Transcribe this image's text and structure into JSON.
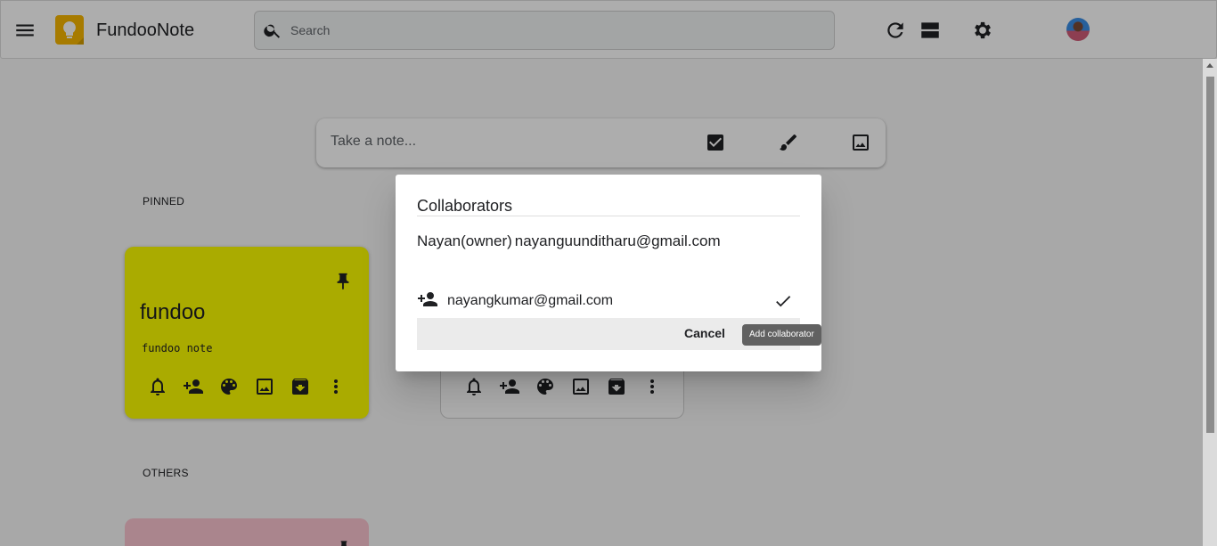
{
  "header": {
    "app_title": "FundooNote",
    "search_placeholder": "Search",
    "icons": [
      "menu-icon",
      "keep-logo-icon",
      "search-icon",
      "refresh-icon",
      "list-view-icon",
      "settings-icon",
      "avatar"
    ]
  },
  "composer": {
    "placeholder": "Take a note...",
    "icons": [
      "checkbox-icon",
      "brush-icon",
      "image-icon"
    ]
  },
  "sections": {
    "pinned": "PINNED",
    "others": "OTHERS"
  },
  "notes": [
    {
      "title": "fundoo",
      "body": "fundoo note",
      "color": "#fbfd00",
      "pinned": true
    },
    {
      "title": "",
      "body": "",
      "color": "#ffffff",
      "pinned": true
    },
    {
      "title": "",
      "body": "",
      "color": "#fbc5d0",
      "pinned": true
    }
  ],
  "note_tool_icons": [
    "reminder-icon",
    "collaborator-icon",
    "palette-icon",
    "image-icon",
    "archive-icon",
    "more-icon"
  ],
  "dialog": {
    "title": "Collaborators",
    "owner_name": "Nayan(owner)",
    "owner_email": "nayanguunditharu@gmail.com",
    "collaborator_email": "nayangkumar@gmail.com",
    "cancel_label": "Cancel",
    "tooltip": "Add collaborator"
  },
  "colors": {
    "accent_logo": "#f7b500",
    "note_yellow": "#fbfd00",
    "note_pink": "#fbc5d0"
  }
}
